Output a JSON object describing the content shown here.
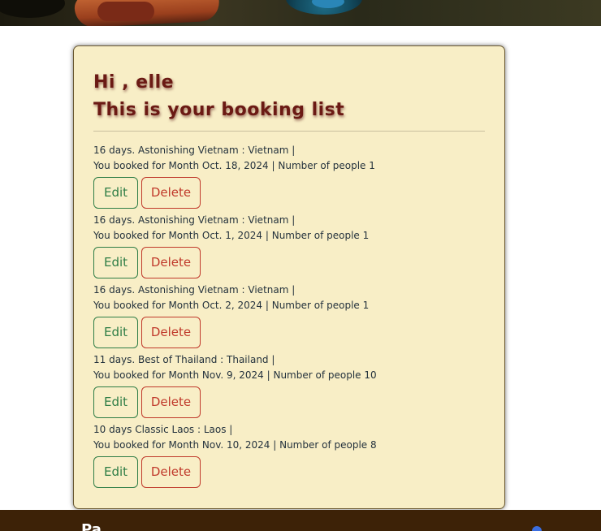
{
  "greeting": "Hi , elle",
  "page_title": "This is your booking list",
  "bookings": [
    {
      "trip": "16 days. Astonishing Vietnam : Vietnam |",
      "detail": "You booked for Month Oct. 18, 2024 | Number of people 1",
      "edit_label": "Edit",
      "delete_label": "Delete"
    },
    {
      "trip": "16 days. Astonishing Vietnam : Vietnam |",
      "detail": "You booked for Month Oct. 1, 2024 | Number of people 1",
      "edit_label": "Edit",
      "delete_label": "Delete"
    },
    {
      "trip": "16 days. Astonishing Vietnam : Vietnam |",
      "detail": "You booked for Month Oct. 2, 2024 | Number of people 1",
      "edit_label": "Edit",
      "delete_label": "Delete"
    },
    {
      "trip": "11 days. Best of Thailand : Thailand |",
      "detail": "You booked for Month Nov. 9, 2024 | Number of people 10",
      "edit_label": "Edit",
      "delete_label": "Delete"
    },
    {
      "trip": "10 days Classic Laos : Laos |",
      "detail": "You booked for Month Nov. 10, 2024 | Number of people 8",
      "edit_label": "Edit",
      "delete_label": "Delete"
    }
  ],
  "footer": {
    "title": "Pa...",
    "right_text": "..."
  },
  "colors": {
    "card_bg": "#f8eec6",
    "heading": "#6b1a14",
    "edit": "#2e7d46",
    "delete": "#c0392b",
    "footer_bg": "#3d2207"
  }
}
